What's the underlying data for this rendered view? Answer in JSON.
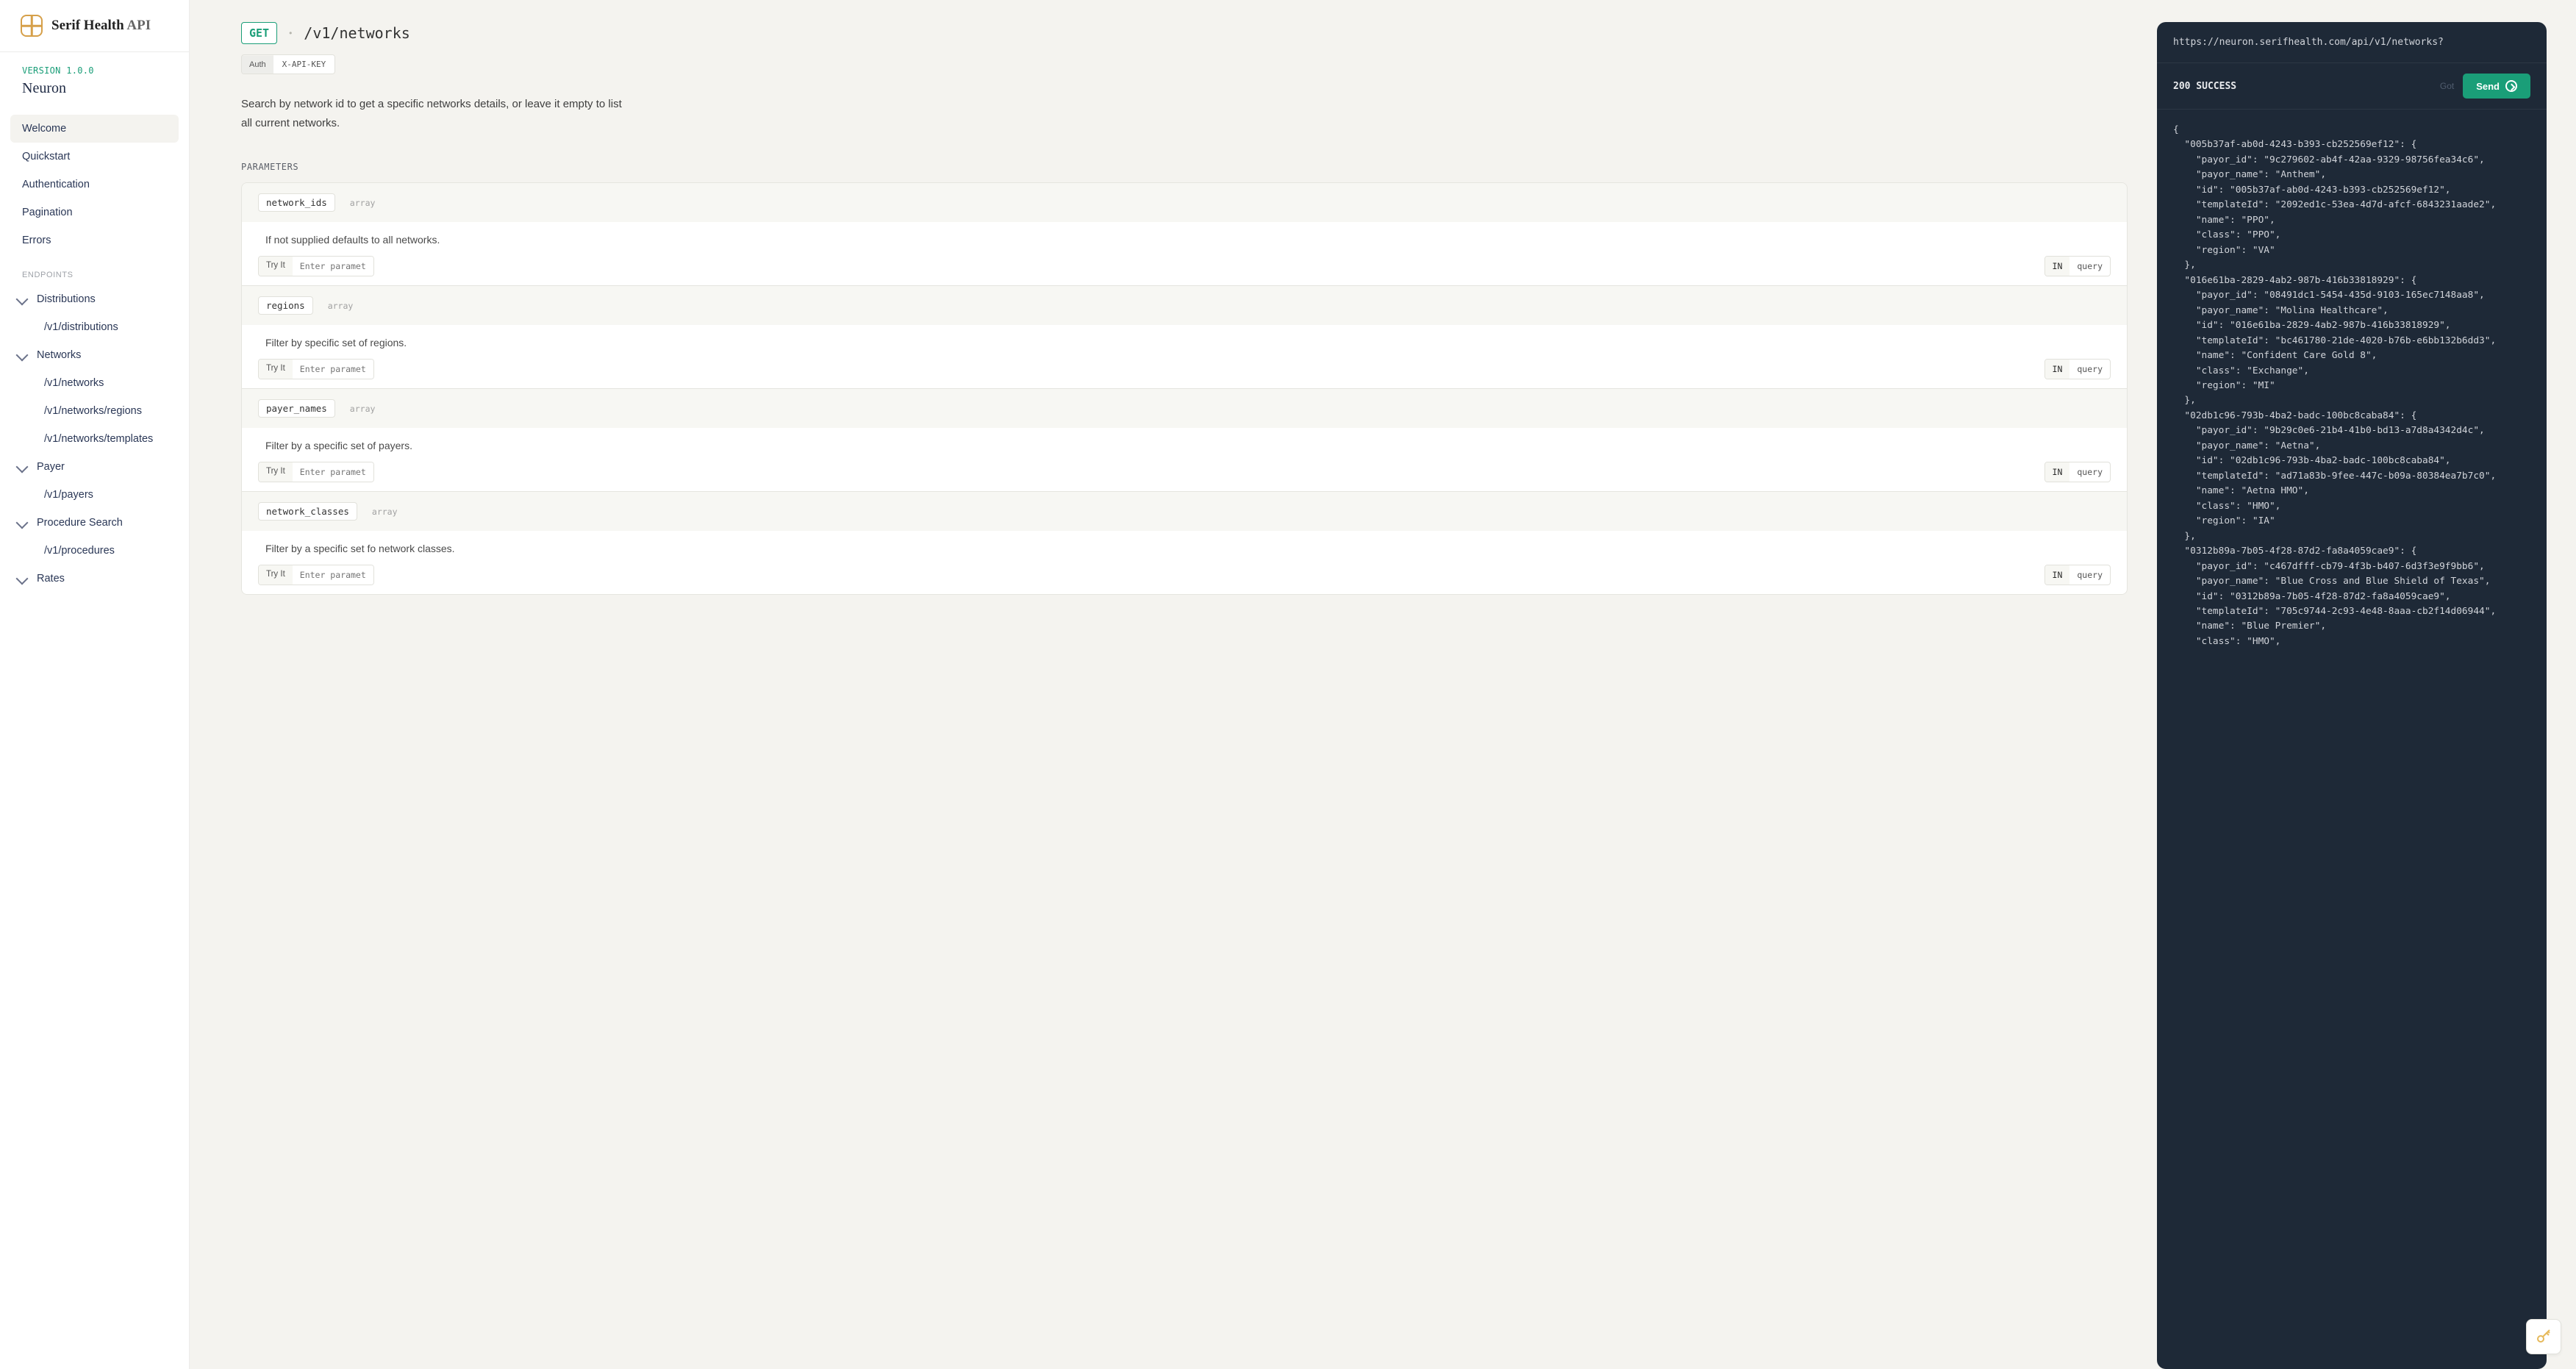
{
  "brand": {
    "name": "Serif Health",
    "suffix": "API"
  },
  "sidebar": {
    "version": "VERSION 1.0.0",
    "product": "Neuron",
    "items": [
      {
        "label": "Welcome",
        "active": true
      },
      {
        "label": "Quickstart"
      },
      {
        "label": "Authentication"
      },
      {
        "label": "Pagination"
      },
      {
        "label": "Errors"
      }
    ],
    "endpoints_label": "ENDPOINTS",
    "groups": [
      {
        "label": "Distributions",
        "children": [
          "/v1/distributions"
        ]
      },
      {
        "label": "Networks",
        "children": [
          "/v1/networks",
          "/v1/networks/regions",
          "/v1/networks/templates"
        ]
      },
      {
        "label": "Payer",
        "children": [
          "/v1/payers"
        ]
      },
      {
        "label": "Procedure Search",
        "children": [
          "/v1/procedures"
        ]
      },
      {
        "label": "Rates",
        "children": []
      }
    ]
  },
  "endpoint": {
    "method": "GET",
    "path": "/v1/networks",
    "auth_label": "Auth",
    "auth_scheme": "X-API-KEY",
    "description": "Search by network id to get a specific networks details, or leave it empty to list all current networks.",
    "params_label": "PARAMETERS",
    "try_label": "Try It",
    "try_placeholder": "Enter parameter",
    "loc_in": "IN",
    "loc_val": "query",
    "params": [
      {
        "name": "network_ids",
        "type": "array",
        "desc": "If not supplied defaults to all networks."
      },
      {
        "name": "regions",
        "type": "array",
        "desc": "Filter by specific set of regions."
      },
      {
        "name": "payer_names",
        "type": "array",
        "desc": "Filter by a specific set of payers."
      },
      {
        "name": "network_classes",
        "type": "array",
        "desc": "Filter by a specific set fo network classes."
      }
    ]
  },
  "response": {
    "url": "https://neuron.serifhealth.com/api/v1/networks?",
    "status": "200 SUCCESS",
    "hint": "Got",
    "send_label": "Send",
    "body": "{\n  \"005b37af-ab0d-4243-b393-cb252569ef12\": {\n    \"payor_id\": \"9c279602-ab4f-42aa-9329-98756fea34c6\",\n    \"payor_name\": \"Anthem\",\n    \"id\": \"005b37af-ab0d-4243-b393-cb252569ef12\",\n    \"templateId\": \"2092ed1c-53ea-4d7d-afcf-6843231aade2\",\n    \"name\": \"PPO\",\n    \"class\": \"PPO\",\n    \"region\": \"VA\"\n  },\n  \"016e61ba-2829-4ab2-987b-416b33818929\": {\n    \"payor_id\": \"08491dc1-5454-435d-9103-165ec7148aa8\",\n    \"payor_name\": \"Molina Healthcare\",\n    \"id\": \"016e61ba-2829-4ab2-987b-416b33818929\",\n    \"templateId\": \"bc461780-21de-4020-b76b-e6bb132b6dd3\",\n    \"name\": \"Confident Care Gold 8\",\n    \"class\": \"Exchange\",\n    \"region\": \"MI\"\n  },\n  \"02db1c96-793b-4ba2-badc-100bc8caba84\": {\n    \"payor_id\": \"9b29c0e6-21b4-41b0-bd13-a7d8a4342d4c\",\n    \"payor_name\": \"Aetna\",\n    \"id\": \"02db1c96-793b-4ba2-badc-100bc8caba84\",\n    \"templateId\": \"ad71a83b-9fee-447c-b09a-80384ea7b7c0\",\n    \"name\": \"Aetna HMO\",\n    \"class\": \"HMO\",\n    \"region\": \"IA\"\n  },\n  \"0312b89a-7b05-4f28-87d2-fa8a4059cae9\": {\n    \"payor_id\": \"c467dfff-cb79-4f3b-b407-6d3f3e9f9bb6\",\n    \"payor_name\": \"Blue Cross and Blue Shield of Texas\",\n    \"id\": \"0312b89a-7b05-4f28-87d2-fa8a4059cae9\",\n    \"templateId\": \"705c9744-2c93-4e48-8aaa-cb2f14d06944\",\n    \"name\": \"Blue Premier\",\n    \"class\": \"HMO\","
  }
}
